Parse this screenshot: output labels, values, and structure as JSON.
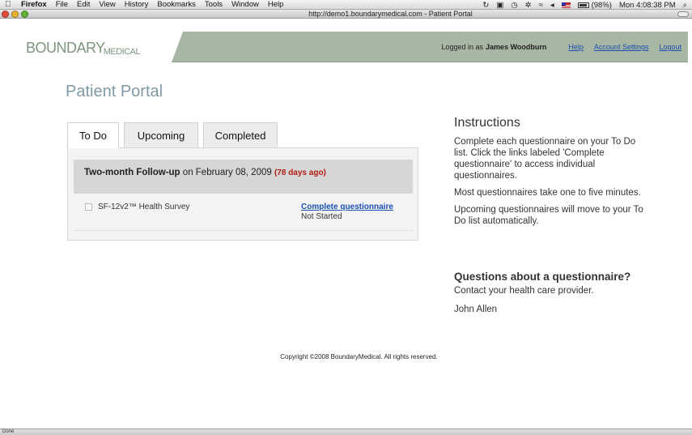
{
  "menubar": {
    "app": "Firefox",
    "items": [
      "File",
      "Edit",
      "View",
      "History",
      "Bookmarks",
      "Tools",
      "Window",
      "Help"
    ],
    "battery": "(98%)",
    "clock": "Mon 4:08:38 PM"
  },
  "window": {
    "title": "http://demo1.boundarymedical.com - Patient Portal"
  },
  "header": {
    "logo_main": "BOUNDARY",
    "logo_sub": "MEDICAL",
    "logged_in_prefix": "Logged in as",
    "user_name": "James Woodburn",
    "links": {
      "help": "Help",
      "account": "Account Settings",
      "logout": "Logout"
    }
  },
  "page": {
    "title": "Patient Portal",
    "tabs": {
      "todo": "To Do",
      "upcoming": "Upcoming",
      "completed": "Completed"
    },
    "group": {
      "name": "Two-month Follow-up",
      "on": "on February 08, 2009",
      "ago": "(78 days ago)"
    },
    "questionnaire": {
      "name": "SF-12v2™ Health Survey",
      "link": "Complete questionnaire",
      "status": "Not Started"
    }
  },
  "instructions": {
    "heading": "Instructions",
    "p1": "Complete each questionnaire on your To Do list. Click the links labeled 'Complete questionnaire' to access individual questionnaires.",
    "p2": "Most questionnaires take one to five minutes.",
    "p3": "Upcoming questionnaires will move to your To Do list automatically."
  },
  "questions": {
    "heading": "Questions about a questionnaire?",
    "p1": "Contact your health care provider.",
    "contact": "John Allen"
  },
  "footer": {
    "copyright": "Copyright ©2008 BoundaryMedical. All rights reserved."
  },
  "statusbar": {
    "text": "Done"
  }
}
